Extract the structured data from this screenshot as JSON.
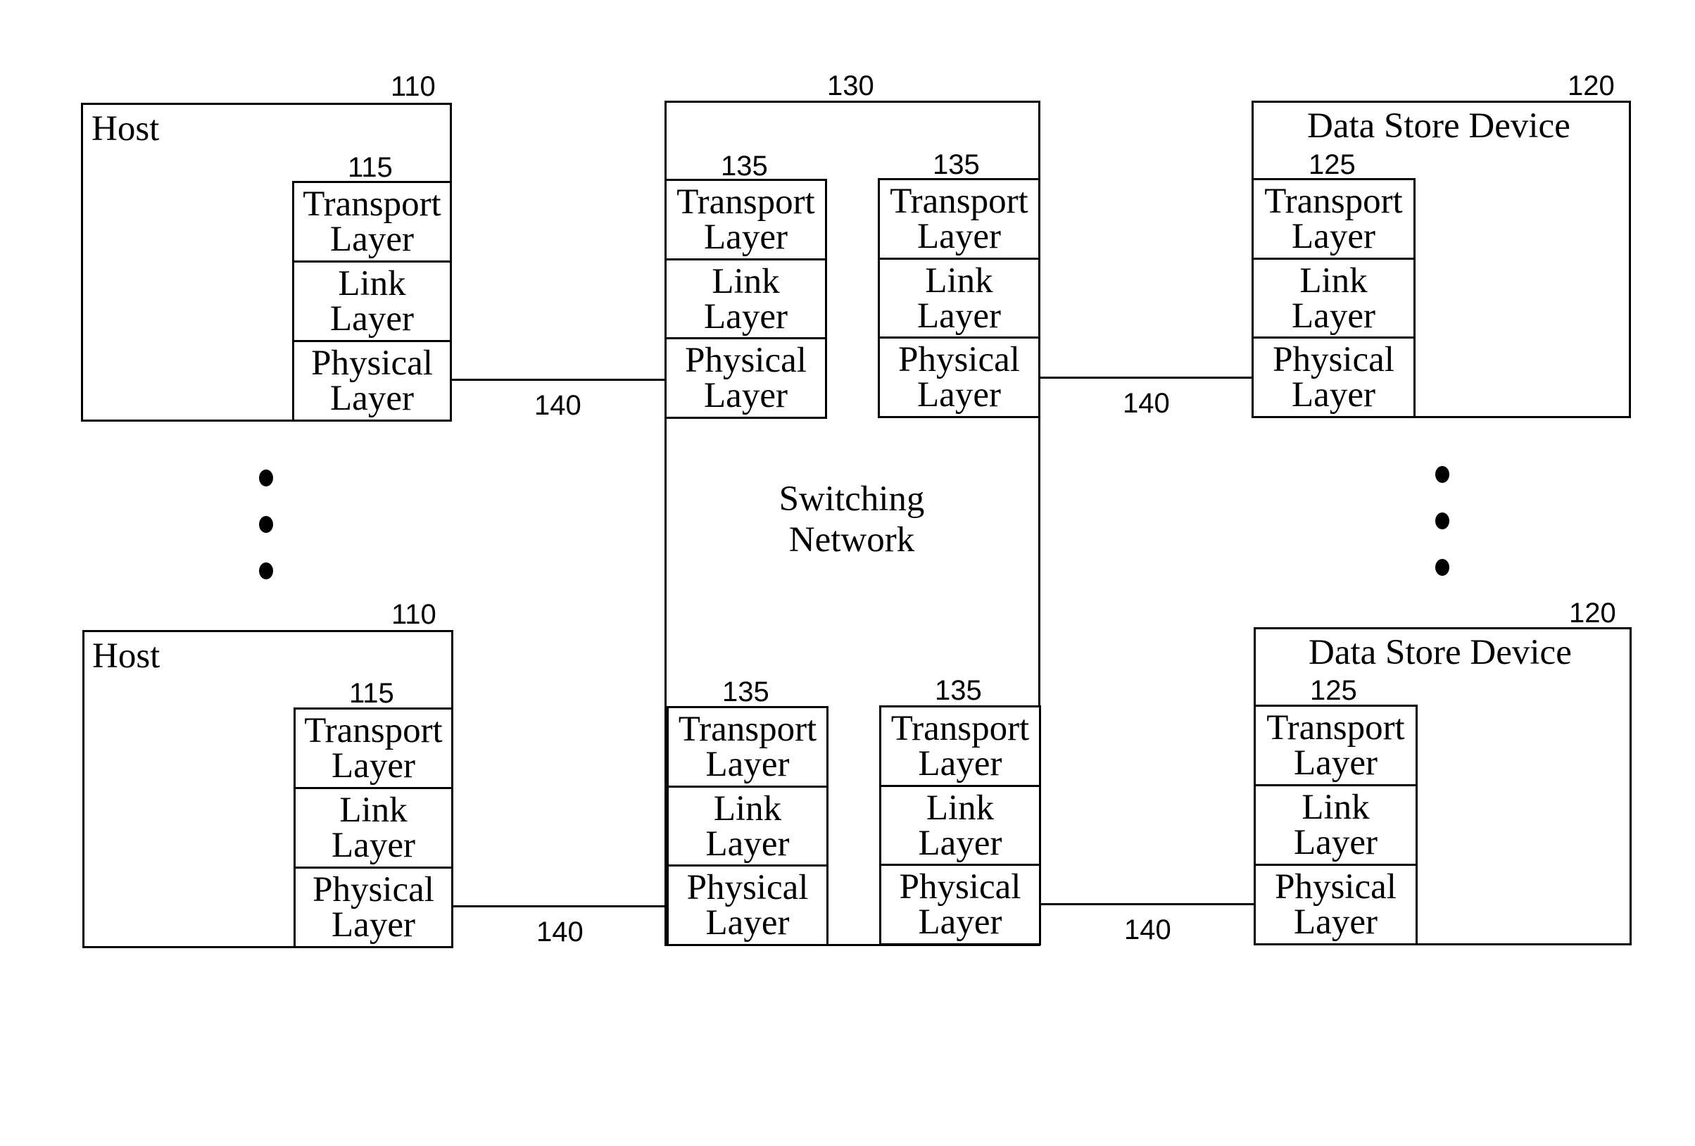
{
  "hosts": [
    {
      "title": "Host",
      "ref": "110",
      "stack_ref": "115",
      "layers": [
        [
          "Transport",
          "Layer"
        ],
        [
          "Link",
          "Layer"
        ],
        [
          "Physical",
          "Layer"
        ]
      ]
    },
    {
      "title": "Host",
      "ref": "110",
      "stack_ref": "115",
      "layers": [
        [
          "Transport",
          "Layer"
        ],
        [
          "Link",
          "Layer"
        ],
        [
          "Physical",
          "Layer"
        ]
      ]
    }
  ],
  "switch": {
    "ref": "130",
    "label_line1": "Switching",
    "label_line2": "Network",
    "stacks": [
      {
        "ref": "135",
        "layers": [
          [
            "Transport",
            "Layer"
          ],
          [
            "Link",
            "Layer"
          ],
          [
            "Physical",
            "Layer"
          ]
        ]
      },
      {
        "ref": "135",
        "layers": [
          [
            "Transport",
            "Layer"
          ],
          [
            "Link",
            "Layer"
          ],
          [
            "Physical",
            "Layer"
          ]
        ]
      },
      {
        "ref": "135",
        "layers": [
          [
            "Transport",
            "Layer"
          ],
          [
            "Link",
            "Layer"
          ],
          [
            "Physical",
            "Layer"
          ]
        ]
      },
      {
        "ref": "135",
        "layers": [
          [
            "Transport",
            "Layer"
          ],
          [
            "Link",
            "Layer"
          ],
          [
            "Physical",
            "Layer"
          ]
        ]
      }
    ]
  },
  "data_stores": [
    {
      "title": "Data Store Device",
      "ref": "120",
      "stack_ref": "125",
      "layers": [
        [
          "Transport",
          "Layer"
        ],
        [
          "Link",
          "Layer"
        ],
        [
          "Physical",
          "Layer"
        ]
      ]
    },
    {
      "title": "Data Store Device",
      "ref": "120",
      "stack_ref": "125",
      "layers": [
        [
          "Transport",
          "Layer"
        ],
        [
          "Link",
          "Layer"
        ],
        [
          "Physical",
          "Layer"
        ]
      ]
    }
  ],
  "links": [
    {
      "ref": "140"
    },
    {
      "ref": "140"
    },
    {
      "ref": "140"
    },
    {
      "ref": "140"
    }
  ],
  "ellipsis": {
    "dot_count": 3
  }
}
